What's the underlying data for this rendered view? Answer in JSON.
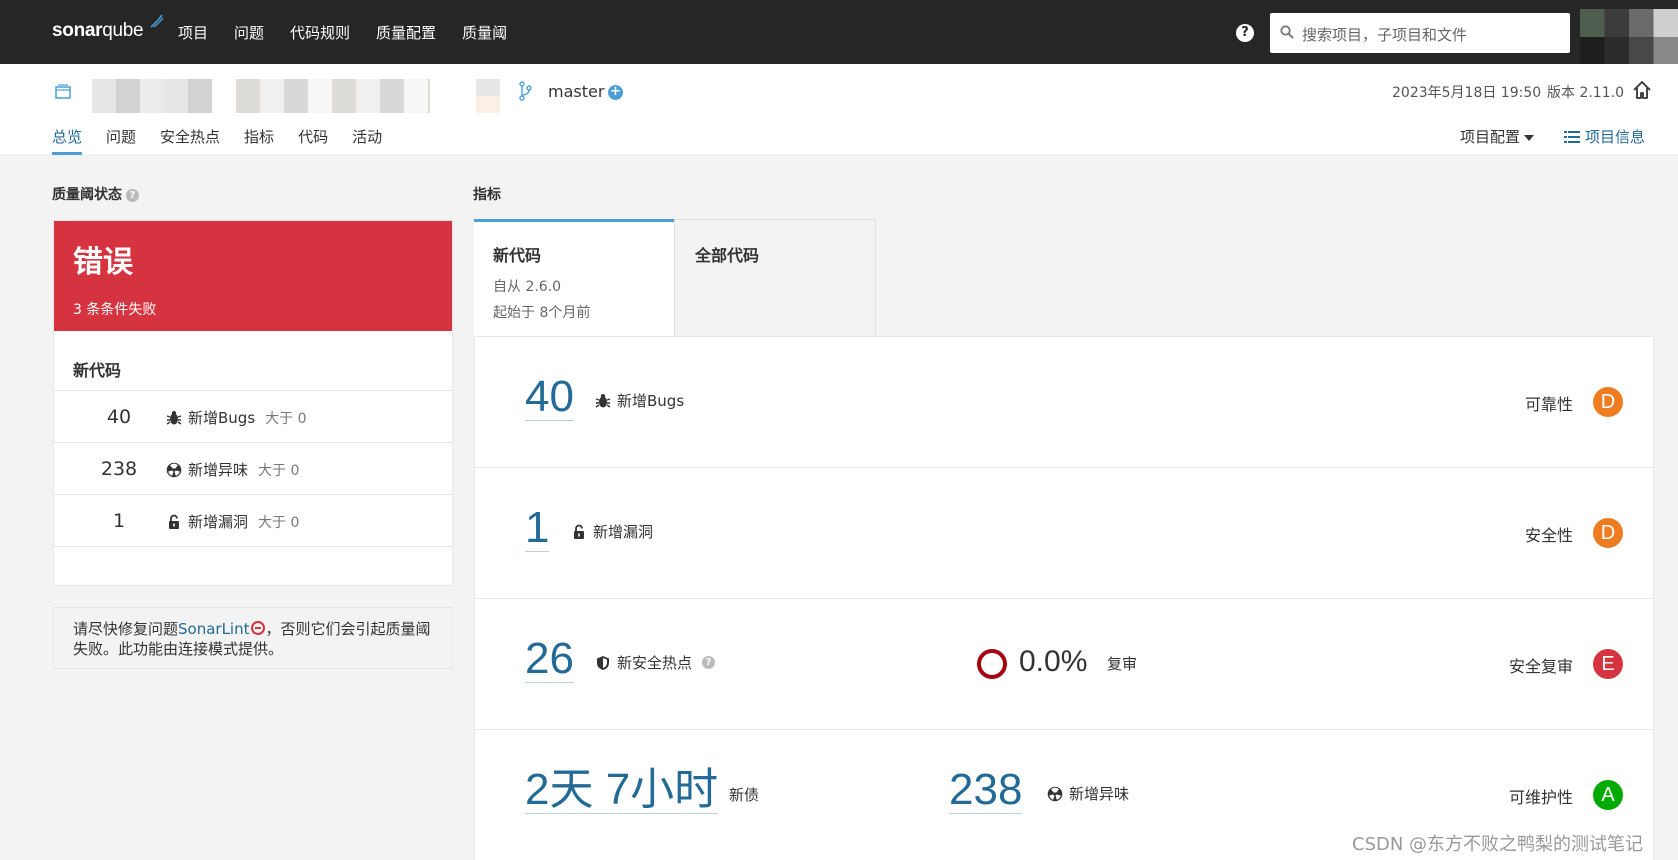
{
  "topbar": {
    "logo_bold": "sonar",
    "logo_light": "qube",
    "nav": [
      "项目",
      "问题",
      "代码规则",
      "质量配置",
      "质量阈"
    ],
    "search_placeholder": "搜索项目，子项目和文件"
  },
  "project": {
    "branch": "master",
    "date": "2023年5月18日 19:50",
    "version": "版本 2.11.0",
    "tabs": [
      "总览",
      "问题",
      "安全热点",
      "指标",
      "代码",
      "活动"
    ],
    "config_label": "项目配置",
    "info_label": "项目信息"
  },
  "quality_gate": {
    "title": "质量阈状态",
    "status": "错误",
    "summary": "3 条条件失败",
    "section": "新代码",
    "conditions": [
      {
        "value": "40",
        "label": "新增Bugs",
        "op": "大于 0",
        "icon": "bug-icon"
      },
      {
        "value": "238",
        "label": "新增异味",
        "op": "大于 0",
        "icon": "code-smell-icon"
      },
      {
        "value": "1",
        "label": "新增漏洞",
        "op": "大于 0",
        "icon": "unlock-icon"
      }
    ],
    "note_pre": "请尽快修复问题",
    "note_link": "SonarLint",
    "note_post": "，否则它们会引起质量阈失败。此功能由连接模式提供。"
  },
  "metrics": {
    "title": "指标",
    "tab_new": {
      "title": "新代码",
      "since": "自从 2.6.0",
      "ago": "起始于 8个月前"
    },
    "tab_all": {
      "title": "全部代码"
    },
    "rows": [
      {
        "value": "40",
        "label": "新增Bugs",
        "rating_label": "可靠性",
        "rating": "D",
        "rating_color": "#ed7d20"
      },
      {
        "value": "1",
        "label": "新增漏洞",
        "rating_label": "安全性",
        "rating": "D",
        "rating_color": "#ed7d20"
      },
      {
        "value": "26",
        "label": "新安全热点",
        "review_pct": "0.0%",
        "review_label": "复审",
        "rating_label": "安全复审",
        "rating": "E",
        "rating_color": "#d4333f"
      },
      {
        "value": "2天 7小时",
        "label": "新债",
        "smells": "238",
        "smells_label": "新增异味",
        "rating_label": "可维护性",
        "rating": "A",
        "rating_color": "#00aa00"
      }
    ]
  },
  "colors": {
    "accent": "#4b9fd5",
    "link": "#236a97",
    "error": "#d4333f",
    "topbar": "#262626"
  },
  "watermark": "CSDN @东方不败之鸭梨的测试笔记"
}
